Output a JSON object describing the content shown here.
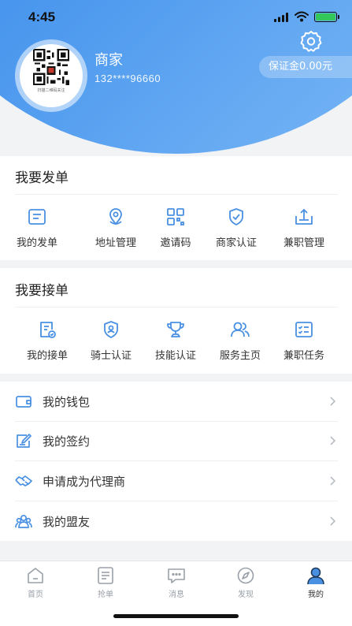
{
  "status_bar": {
    "time": "4:45"
  },
  "profile": {
    "name": "商家",
    "phone": "132****96660",
    "deposit_label": "保证金0.00元",
    "avatar_caption": "扫描二维码关注"
  },
  "post_section": {
    "title": "我要发单",
    "items": [
      {
        "label": "我的发单",
        "icon": "order-list-icon"
      },
      {
        "label": "地址管理",
        "icon": "location-icon"
      },
      {
        "label": "邀请码",
        "icon": "qr-code-icon"
      },
      {
        "label": "商家认证",
        "icon": "shield-check-icon"
      },
      {
        "label": "兼职管理",
        "icon": "upload-tray-icon"
      }
    ]
  },
  "accept_section": {
    "title": "我要接单",
    "items": [
      {
        "label": "我的接单",
        "icon": "document-check-icon"
      },
      {
        "label": "骑士认证",
        "icon": "rider-shield-icon"
      },
      {
        "label": "技能认证",
        "icon": "trophy-icon"
      },
      {
        "label": "服务主页",
        "icon": "users-icon"
      },
      {
        "label": "兼职任务",
        "icon": "checklist-icon"
      }
    ]
  },
  "menu": [
    {
      "label": "我的钱包",
      "icon": "wallet-icon"
    },
    {
      "label": "我的签约",
      "icon": "sign-edit-icon"
    },
    {
      "label": "申请成为代理商",
      "icon": "handshake-icon"
    },
    {
      "label": "我的盟友",
      "icon": "allies-icon"
    }
  ],
  "tabbar": {
    "tabs": [
      {
        "label": "首页",
        "icon": "home-icon"
      },
      {
        "label": "抢单",
        "icon": "grab-order-icon"
      },
      {
        "label": "消息",
        "icon": "message-icon"
      },
      {
        "label": "发现",
        "icon": "compass-icon"
      },
      {
        "label": "我的",
        "icon": "profile-icon"
      }
    ],
    "active": "我的"
  },
  "colors": {
    "accent": "#3a8ae6",
    "icon_blue": "#4a90e2",
    "text": "#333333",
    "background": "#f2f3f5"
  }
}
